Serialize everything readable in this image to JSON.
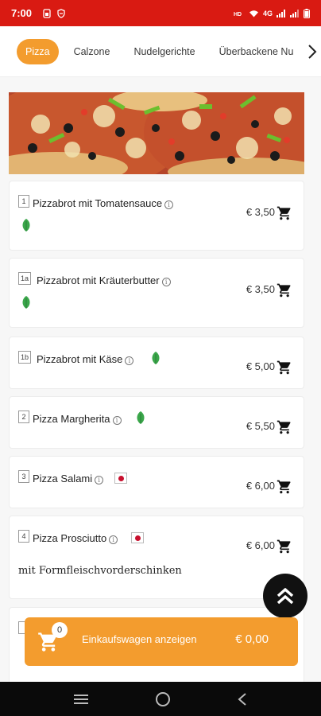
{
  "status": {
    "time": "7:00",
    "network": "4G"
  },
  "tabs": [
    {
      "label": "Pizza",
      "active": true
    },
    {
      "label": "Calzone",
      "active": false
    },
    {
      "label": "Nudelgerichte",
      "active": false
    },
    {
      "label": "Überbackene Nu",
      "active": false
    }
  ],
  "items": [
    {
      "number": "1",
      "name": "Pizzabrot mit Tomatensauce",
      "price": "€ 3,50",
      "badge": "veggie-leaf"
    },
    {
      "number": "1a",
      "name": "Pizzabrot mit Kräuterbutter",
      "price": "€ 3,50",
      "badge": "veggie-leaf"
    },
    {
      "number": "1b",
      "name": "Pizzabrot mit Käse",
      "price": "€ 5,00",
      "badge": "veggie-leaf"
    },
    {
      "number": "2",
      "name": "Pizza Margherita",
      "price": "€ 5,50",
      "badge": "veggie-leaf"
    },
    {
      "number": "3",
      "name": "Pizza Salami",
      "price": "€ 6,00",
      "badge": "pork-flag"
    },
    {
      "number": "4",
      "name": "Pizza Prosciutto",
      "price": "€ 6,00",
      "badge": "pork-flag",
      "description": "mit Formfleischvorderschinken"
    }
  ],
  "cart": {
    "count": "0",
    "label": "Einkaufswagen anzeigen",
    "total": "€ 0,00"
  },
  "colors": {
    "status_bar": "#d91a12",
    "accent": "#f39c2e",
    "veggie": "#3aa64a"
  }
}
